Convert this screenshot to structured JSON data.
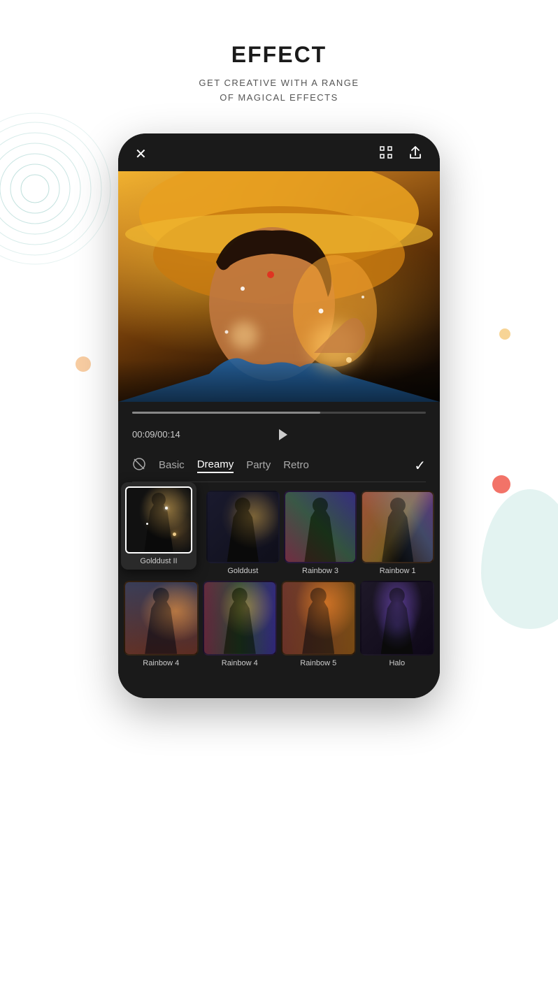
{
  "header": {
    "title": "EFFECT",
    "subtitle": "GET CREATIVE WITH A RANGE\nOF MAGICAL EFFECTS"
  },
  "topbar": {
    "close_label": "×",
    "fullscreen_label": "⛶",
    "share_label": "↑"
  },
  "playback": {
    "time_current": "00:09",
    "time_total": "00:14",
    "time_display": "00:09/00:14"
  },
  "effect_tabs": [
    {
      "label": "Basic",
      "active": false
    },
    {
      "label": "Dreamy",
      "active": true
    },
    {
      "label": "Party",
      "active": false
    },
    {
      "label": "Retro",
      "active": false
    }
  ],
  "selected_effect": {
    "label": "Golddust II",
    "thumb_type": "golddust-ii"
  },
  "effects_row1": [
    {
      "label": "Golddust",
      "thumb_type": "golddust"
    },
    {
      "label": "Rainbow 3",
      "thumb_type": "rainbow3"
    },
    {
      "label": "Rainbow 1",
      "thumb_type": "rainbow1"
    }
  ],
  "effects_row2": [
    {
      "label": "Rainbow 4",
      "thumb_type": "rainbow4"
    },
    {
      "label": "Rainbow 4",
      "thumb_type": "rainbow4b"
    },
    {
      "label": "Rainbow 5",
      "thumb_type": "rainbow5"
    },
    {
      "label": "Halo",
      "thumb_type": "halo"
    }
  ]
}
